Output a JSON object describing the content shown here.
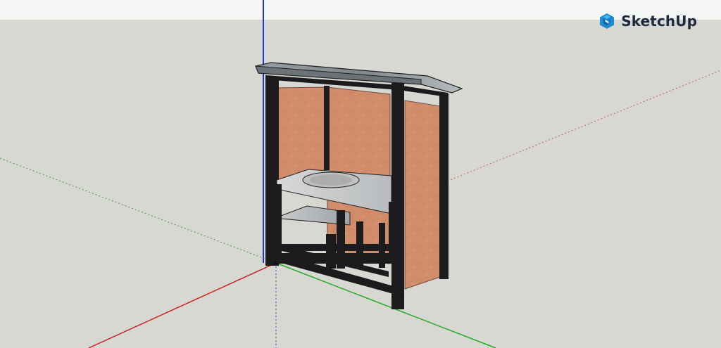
{
  "app": {
    "brand_name": "SketchUp",
    "brand_icon": "sketchup-logo-icon",
    "accent_color": "#1b2a3f"
  },
  "viewport": {
    "axes": {
      "red": "#cc2222",
      "green": "#22aa22",
      "blue": "#2233cc"
    },
    "model": {
      "frame_color": "#1b1b1d",
      "panel_color": "#d08d6b",
      "shelf_color": "#c9cbcc",
      "roof_color": "#8d9599"
    }
  }
}
